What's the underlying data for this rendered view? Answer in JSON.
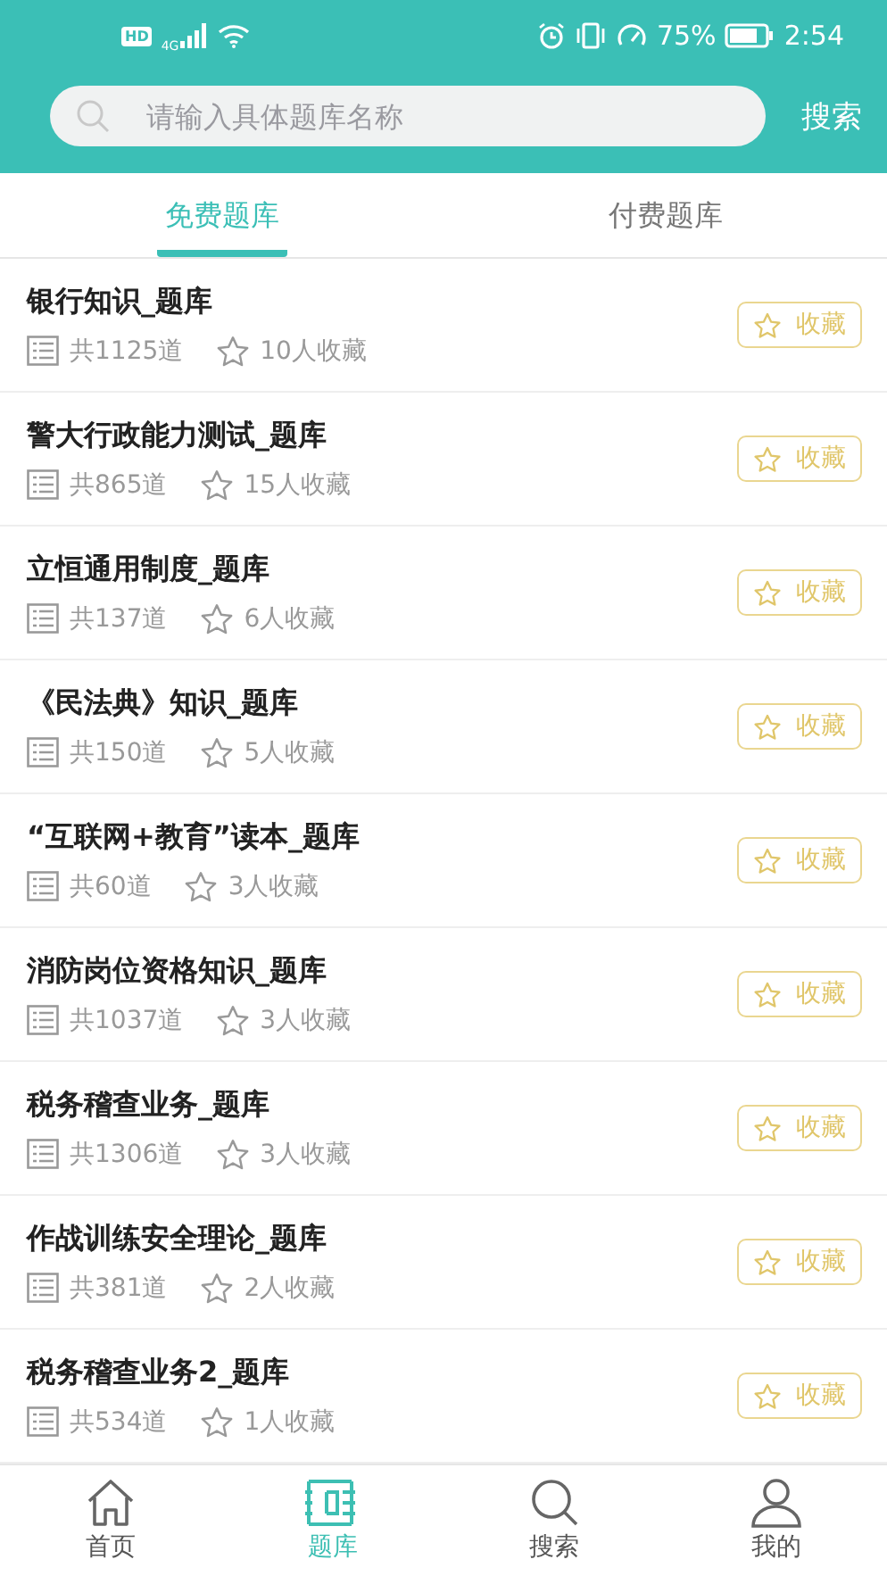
{
  "status_bar": {
    "hd": "HD",
    "network": "4G",
    "battery_percent": "75%",
    "time": "2:54"
  },
  "search": {
    "placeholder": "请输入具体题库名称",
    "button": "搜索"
  },
  "tabs": [
    {
      "label": "免费题库",
      "selected": true
    },
    {
      "label": "付费题库",
      "selected": false
    }
  ],
  "banks": [
    {
      "title": "银行知识_题库",
      "count": "共1125道",
      "favorites": "10人收藏",
      "action": "收藏"
    },
    {
      "title": "警大行政能力测试_题库",
      "count": "共865道",
      "favorites": "15人收藏",
      "action": "收藏"
    },
    {
      "title": "立恒通用制度_题库",
      "count": "共137道",
      "favorites": "6人收藏",
      "action": "收藏"
    },
    {
      "title": "《民法典》知识_题库",
      "count": "共150道",
      "favorites": "5人收藏",
      "action": "收藏"
    },
    {
      "title": "“互联网+教育”读本_题库",
      "count": "共60道",
      "favorites": "3人收藏",
      "action": "收藏"
    },
    {
      "title": "消防岗位资格知识_题库",
      "count": "共1037道",
      "favorites": "3人收藏",
      "action": "收藏"
    },
    {
      "title": "税务稽查业务_题库",
      "count": "共1306道",
      "favorites": "3人收藏",
      "action": "收藏"
    },
    {
      "title": "作战训练安全理论_题库",
      "count": "共381道",
      "favorites": "2人收藏",
      "action": "收藏"
    },
    {
      "title": "税务稽查业务2_题库",
      "count": "共534道",
      "favorites": "1人收藏",
      "action": "收藏"
    }
  ],
  "nav": [
    {
      "label": "首页",
      "kind": "home",
      "selected": false
    },
    {
      "label": "题库",
      "kind": "bank",
      "selected": true
    },
    {
      "label": "搜索",
      "kind": "search",
      "selected": false
    },
    {
      "label": "我的",
      "kind": "user",
      "selected": false
    }
  ]
}
